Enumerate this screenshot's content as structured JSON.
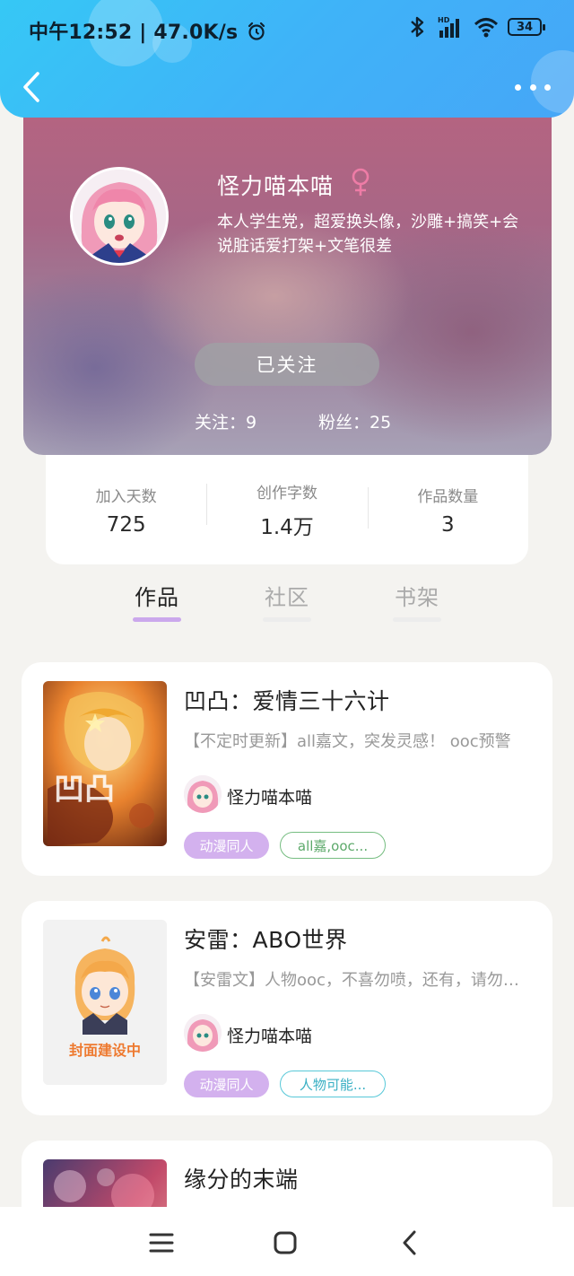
{
  "status_bar": {
    "time_speed": "中午12:52 | 47.0K/s",
    "battery": "34",
    "icons": [
      "alarm-icon",
      "bluetooth-icon",
      "hd-signal-icon",
      "wifi-icon",
      "battery-icon"
    ]
  },
  "header": {
    "back_icon": "back-arrow-icon",
    "more_icon": "more-dots-icon"
  },
  "profile": {
    "name": "怪力喵本喵",
    "gender_icon": "female-icon",
    "bio": "本人学生党，超爱换头像，沙雕+搞笑+会说脏话爱打架+文笔很差",
    "follow_button": "已关注",
    "following": "关注：9",
    "followers": "粉丝：25"
  },
  "stats": [
    {
      "label": "加入天数",
      "value": "725"
    },
    {
      "label": "创作字数",
      "value": "1.4万"
    },
    {
      "label": "作品数量",
      "value": "3"
    }
  ],
  "tabs": [
    {
      "label": "作品",
      "active": true
    },
    {
      "label": "社区",
      "active": false
    },
    {
      "label": "书架",
      "active": false
    }
  ],
  "books": [
    {
      "title": "凹凸：爱情三十六计",
      "description": "【不定时更新】all嘉文，突发灵感！ ooc预警",
      "author": "怪力喵本喵",
      "genre_tag": "动漫同人",
      "keyword_tag": "all嘉,ooc...",
      "cover": "orange-illustration-cover"
    },
    {
      "title": "安雷：ABO世界",
      "description": "【安雷文】人物ooc，不喜勿喷，还有，请勿抄袭",
      "author": "怪力喵本喵",
      "genre_tag": "动漫同人",
      "keyword_tag": "人物可能...",
      "cover_text": "封面建设中"
    },
    {
      "title": "缘分的末端",
      "cover": "purple-illustration-cover"
    }
  ],
  "colors": {
    "header_gradient_start": "#36c8f5",
    "header_gradient_end": "#46a6f7",
    "tab_underline": "#cba8ec",
    "genre_tag": "#d3b1ee",
    "kw_tag_green": "#76bd81",
    "kw_tag_cyan": "#58c8d8"
  },
  "nav": {
    "icons": [
      "menu-icon",
      "home-icon",
      "back-icon"
    ]
  }
}
